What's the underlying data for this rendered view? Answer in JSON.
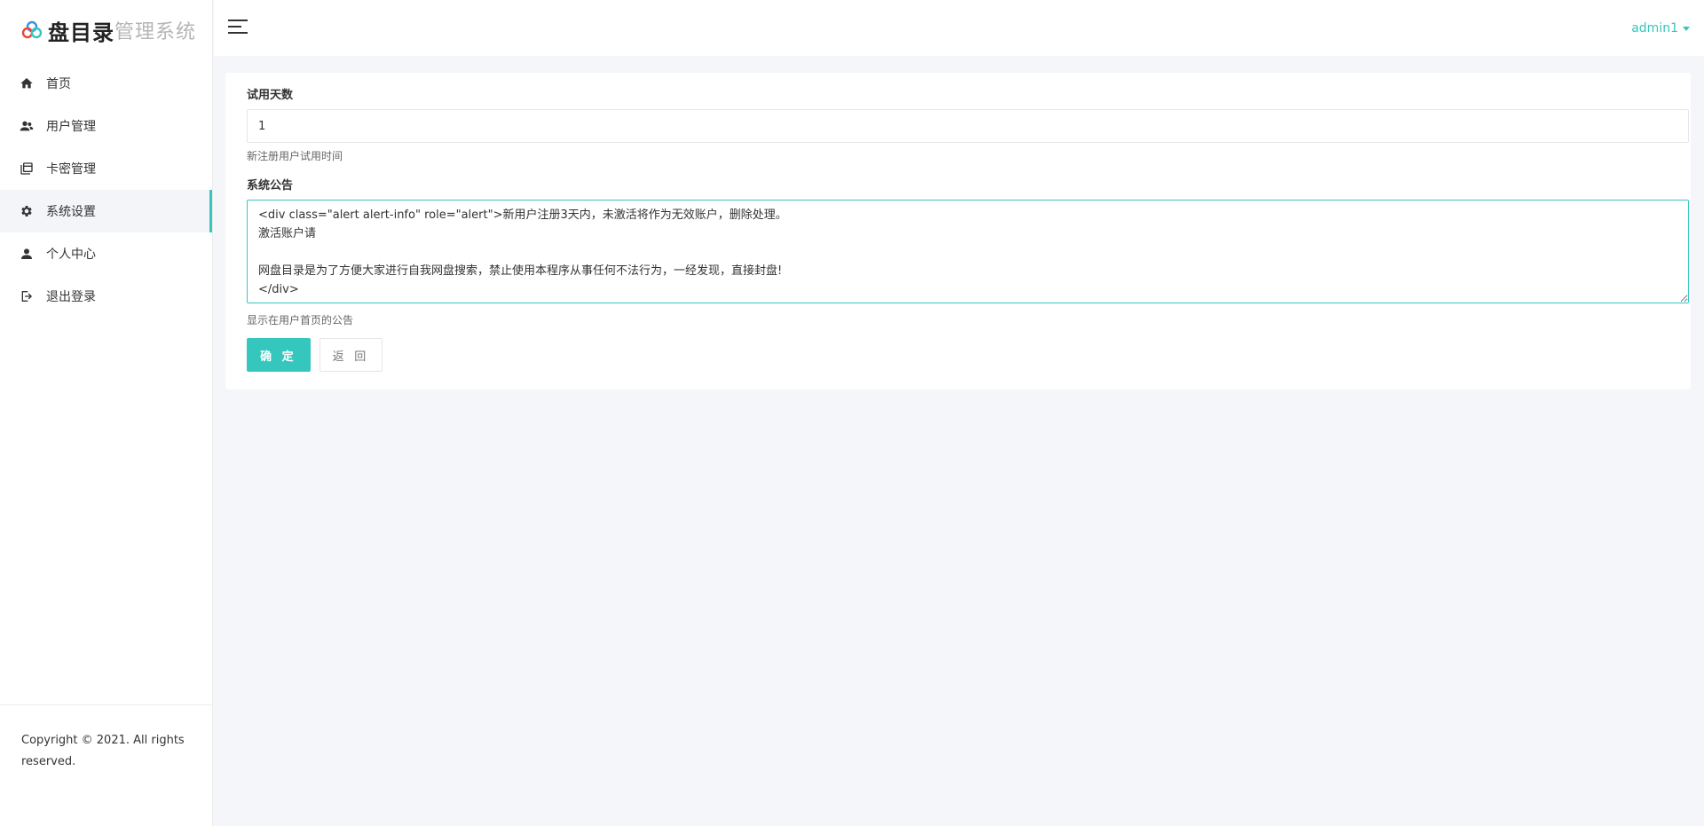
{
  "brand": {
    "main": "盘目录",
    "sub": "管理系统"
  },
  "sidebar": {
    "items": [
      {
        "label": "首页",
        "icon": "home-icon"
      },
      {
        "label": "用户管理",
        "icon": "users-icon"
      },
      {
        "label": "卡密管理",
        "icon": "cards-icon"
      },
      {
        "label": "系统设置",
        "icon": "gear-icon",
        "active": true
      },
      {
        "label": "个人中心",
        "icon": "person-icon"
      },
      {
        "label": "退出登录",
        "icon": "logout-icon"
      }
    ],
    "footer": "Copyright © 2021. All rights reserved."
  },
  "topbar": {
    "user": "admin1"
  },
  "form": {
    "trial_days": {
      "label": "试用天数",
      "value": "1",
      "help": "新注册用户试用时间"
    },
    "notice": {
      "label": "系统公告",
      "value": "<div class=\"alert alert-info\" role=\"alert\">新用户注册3天内，未激活将作为无效账户，删除处理。\n激活账户请\n\n网盘目录是为了方便大家进行自我网盘搜索，禁止使用本程序从事任何不法行为，一经发现，直接封盘!\n</div>",
      "help": "显示在用户首页的公告"
    },
    "confirm_label": "确 定",
    "back_label": "返 回"
  },
  "colors": {
    "accent": "#35c7bd"
  }
}
